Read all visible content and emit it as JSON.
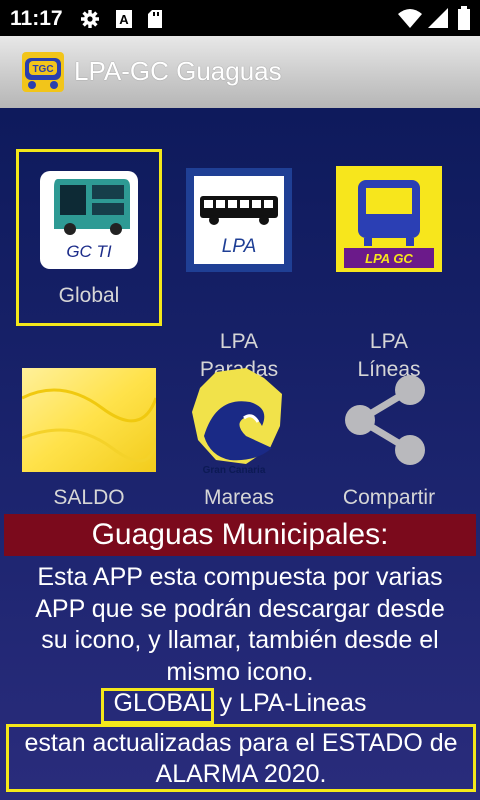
{
  "status_bar": {
    "time": "11:17",
    "icons": [
      "gear-icon",
      "a-icon",
      "sd-card-icon",
      "wifi-icon",
      "signal-icon",
      "battery-icon"
    ]
  },
  "app_bar": {
    "title": "LPA-GC Guaguas",
    "logo_text": "TGC"
  },
  "tiles": [
    {
      "label": "Global",
      "icon": "bus-gc-ti-icon",
      "icon_text": "GC TI"
    },
    {
      "label": "LPA\nParadas",
      "icon": "bus-lpa-icon",
      "icon_text": "LPA"
    },
    {
      "label": "LPA\nLíneas",
      "icon": "bus-lpa-gc-icon",
      "icon_text": "LPA GC"
    },
    {
      "label": "SALDO",
      "icon": "card-icon"
    },
    {
      "label": "Mareas",
      "icon": "wave-island-icon",
      "icon_text": "Gran Canaria"
    },
    {
      "label": "Compartir",
      "icon": "share-icon"
    }
  ],
  "banner": "Guaguas Municipales:",
  "description": [
    "Esta APP esta compuesta por varias",
    "APP que se podrán descargar desde",
    "su icono, y llamar, también desde el",
    "mismo icono."
  ],
  "highlight_line": {
    "global": "GLOBAL",
    "rest": " y LPA-Lineas"
  },
  "note": {
    "line1": "estan actualizadas para el ESTADO de",
    "line2": "ALARMA 2020."
  },
  "colors": {
    "background": "#1b2263",
    "banner": "#7b0a1c",
    "highlight": "#f4e81a"
  }
}
